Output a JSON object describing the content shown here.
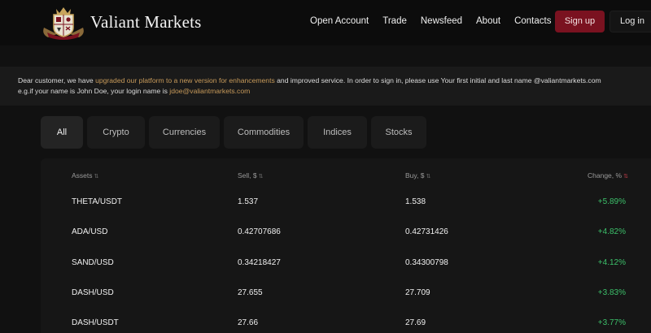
{
  "brand": {
    "name": "Valiant Markets"
  },
  "nav": [
    "Open Account",
    "Trade",
    "Newsfeed",
    "About",
    "Contacts"
  ],
  "auth": {
    "signup": "Sign up",
    "login": "Log in"
  },
  "notice": {
    "l1_a": "Dear customer, we have ",
    "l1_link": "upgraded our platform to a new version for enhancements",
    "l1_b": " and improved service. In order to sign in, please use Your first initial and last name @valiantmarkets.com",
    "l2_a": "e.g.if your name is John Doe, your login name is ",
    "l2_email": "jdoe@valiantmarkets.com"
  },
  "tabs": [
    "All",
    "Crypto",
    "Currencies",
    "Commodities",
    "Indices",
    "Stocks"
  ],
  "columns": {
    "asset": "Assets",
    "sell": "Sell, $",
    "buy": "Buy, $",
    "change": "Change, %"
  },
  "rows": [
    {
      "asset": "THETA/USDT",
      "sell": "1.537",
      "buy": "1.538",
      "change": "+5.89%"
    },
    {
      "asset": "ADA/USD",
      "sell": "0.42707686",
      "buy": "0.42731426",
      "change": "+4.82%"
    },
    {
      "asset": "SAND/USD",
      "sell": "0.34218427",
      "buy": "0.34300798",
      "change": "+4.12%"
    },
    {
      "asset": "DASH/USD",
      "sell": "27.655",
      "buy": "27.709",
      "change": "+3.83%"
    },
    {
      "asset": "DASH/USDT",
      "sell": "27.66",
      "buy": "27.69",
      "change": "+3.77%"
    }
  ],
  "colors": {
    "accent": "#7a1220",
    "link": "#c79a5a",
    "positive": "#3cc06a"
  },
  "icons": {
    "logo": "crest-logo-icon",
    "sort": "sort-arrows-icon"
  }
}
